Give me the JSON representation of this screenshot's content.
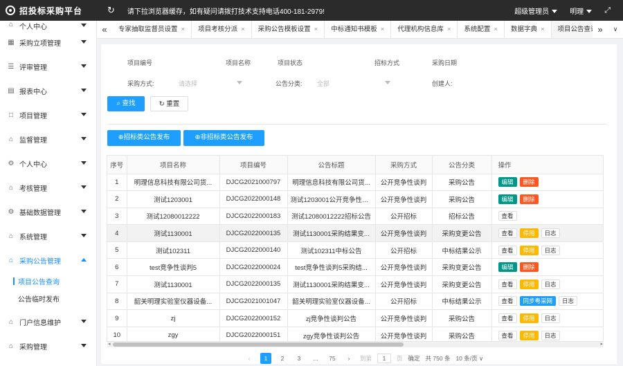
{
  "header": {
    "app_title": "招投标采购平台",
    "notice": "请下拉浏览器缓存，如有疑问请拨打技术支持电话400-181-2979!",
    "role": "超级管理员",
    "user": "明理"
  },
  "sidebar": {
    "items": [
      {
        "label": "个人中心",
        "icon": "user-icon"
      },
      {
        "label": "采购立项管理",
        "icon": "project-icon"
      },
      {
        "label": "评审管理",
        "icon": "list-icon"
      },
      {
        "label": "报表中心",
        "icon": "report-icon"
      },
      {
        "label": "项目管理",
        "icon": "folder-icon"
      },
      {
        "label": "监督管理",
        "icon": "home-icon"
      },
      {
        "label": "个人中心",
        "icon": "gear-icon"
      },
      {
        "label": "考核管理",
        "icon": "home-icon"
      },
      {
        "label": "基础数据管理",
        "icon": "gear-icon"
      },
      {
        "label": "系统管理",
        "icon": "home-icon"
      },
      {
        "label": "采购公告管理",
        "icon": "home-icon",
        "open": true
      },
      {
        "label": "门户信息维护",
        "icon": "home-icon"
      },
      {
        "label": "采购管理",
        "icon": "home-icon"
      }
    ],
    "subitems": [
      {
        "label": "项目公告查询",
        "active": true
      },
      {
        "label": "公告临时发布",
        "active": false
      }
    ]
  },
  "tabs": [
    {
      "label": "专家抽取监督员设置"
    },
    {
      "label": "项目考核分派"
    },
    {
      "label": "采购公告模板设置"
    },
    {
      "label": "中标通知书模板"
    },
    {
      "label": "代理机构信息库"
    },
    {
      "label": "系统配置"
    },
    {
      "label": "数据字典"
    },
    {
      "label": "项目公告查询",
      "active": true
    }
  ],
  "filters": {
    "row1": [
      "项目编号",
      "项目名称",
      "项目状态",
      "招标方式",
      "采购日期"
    ],
    "method_label": "采购方式:",
    "method_placeholder": "请选择",
    "category_label": "公告分类:",
    "category_value": "全部",
    "creator_label": "创建人:",
    "search_label": "查找",
    "reset_label": "重置"
  },
  "actions": {
    "publish_label": "招标类公告发布",
    "publish_nonbid_label": "非招标类公告发布"
  },
  "table": {
    "headers": [
      "序号",
      "项目名称",
      "项目编号",
      "公告标题",
      "采购方式",
      "公告分类",
      "操作"
    ],
    "rows": [
      {
        "no": "1",
        "name": "明理信息科技有限公司货...",
        "code": "DJCG2021000797",
        "title": "明理信息科技有限公司货...",
        "method": "公开竞争性谈判",
        "category": "采购公告",
        "ops": [
          "编辑",
          "删除"
        ]
      },
      {
        "no": "2",
        "name": "测试1203001",
        "code": "DJCG2022000148",
        "title": "测试1203001公开竞争性谈...",
        "method": "公开竞争性谈判",
        "category": "采购公告",
        "ops": [
          "编辑",
          "删除"
        ]
      },
      {
        "no": "3",
        "name": "测试12080012222",
        "code": "DJCG2022000183",
        "title": "测试12080012222招标公告",
        "method": "公开招标",
        "category": "招标公告",
        "ops": [
          "查看"
        ]
      },
      {
        "no": "4",
        "name": "测试1130001",
        "code": "DJCG2022000135",
        "title": "测试1130001采购结果变...",
        "method": "公开竞争性谈判",
        "category": "采购变更公告",
        "ops": [
          "查看",
          "停用",
          "日志"
        ],
        "highlight": true
      },
      {
        "no": "5",
        "name": "测试102311",
        "code": "DJCG2022000140",
        "title": "测试102311中标公告",
        "method": "公开招标",
        "category": "中标结果公示",
        "ops": [
          "查看",
          "停用",
          "日志"
        ]
      },
      {
        "no": "6",
        "name": "test竞争性谈判5",
        "code": "DJCG2022000024",
        "title": "test竞争性谈判5采购结...",
        "method": "公开竞争性谈判",
        "category": "采购变更公告",
        "ops": [
          "编辑",
          "删除"
        ]
      },
      {
        "no": "7",
        "name": "测试1130001",
        "code": "DJCG2022000135",
        "title": "测试1130001采购结果变...",
        "method": "公开竞争性谈判",
        "category": "采购变更公告",
        "ops": [
          "查看",
          "停用",
          "日志"
        ]
      },
      {
        "no": "8",
        "name": "韶关明理实验室仪器设备...",
        "code": "DJCG2021001047",
        "title": "韶关明理实验室仪器设备...",
        "method": "公开招标",
        "category": "中标结果公示",
        "ops": [
          "查看",
          "同步粤采网",
          "日志"
        ]
      },
      {
        "no": "9",
        "name": "zj",
        "code": "DJCG2022000152",
        "title": "zj竞争性谈判公告",
        "method": "公开竞争性谈判",
        "category": "采购公告",
        "ops": [
          "查看",
          "停用",
          "日志"
        ]
      },
      {
        "no": "10",
        "name": "zgy",
        "code": "DJCG2022000151",
        "title": "zgy竞争性谈判公告",
        "method": "公开竞争性谈判",
        "category": "采购公告",
        "ops": [
          "查看",
          "停用",
          "日志"
        ]
      }
    ]
  },
  "pagination": {
    "pages": [
      "1",
      "2",
      "3",
      "...",
      "75"
    ],
    "goto_label": "到第",
    "goto_value": "1",
    "page_unit": "页",
    "confirm_label": "确定",
    "total_label": "共 750 条",
    "page_size_label": "10 条/页"
  }
}
